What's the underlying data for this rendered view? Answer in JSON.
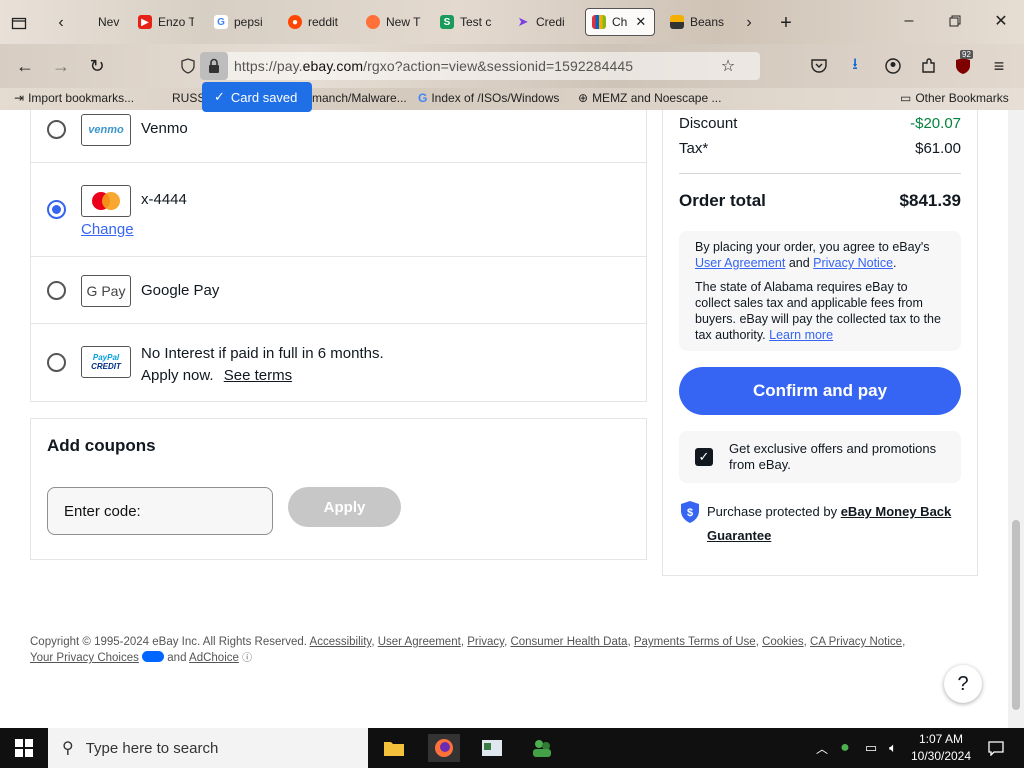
{
  "browser": {
    "tabs": [
      {
        "label": "Nev",
        "fav_color": "#7a7a7a",
        "fav_glyph": "▢"
      },
      {
        "label": "Enzo T",
        "fav_color": "#e62117",
        "fav_glyph": "▶"
      },
      {
        "label": "pepsi",
        "fav_color": "#4285f4",
        "fav_glyph": "G"
      },
      {
        "label": "reddit",
        "fav_color": "#ff4500",
        "fav_glyph": "●"
      },
      {
        "label": "New T",
        "fav_color": "#ff7139",
        "fav_glyph": "●"
      },
      {
        "label": "Test c",
        "fav_color": "#1a9b5c",
        "fav_glyph": "S"
      },
      {
        "label": "Credi",
        "fav_color": "#7b3fe4",
        "fav_glyph": "➤"
      },
      {
        "label": "Ch",
        "fav_color": "#e43137",
        "fav_glyph": "■"
      },
      {
        "label": "Beans",
        "fav_color": "#333333",
        "fav_glyph": "■"
      }
    ],
    "url_prefix": "https://pay.",
    "url_domain": "ebay.com",
    "url_rest": "/rgxo?action=view&sessionid=1592284445",
    "bookmarks": [
      "Import bookmarks...",
      "RUSSI",
      "manch/Malware...",
      "Index of /ISOs/Windows",
      "MEMZ and Noescape ...",
      "Other Bookmarks"
    ],
    "toast": "Card saved",
    "badge": "92"
  },
  "payment": {
    "options": [
      {
        "label": "Venmo",
        "logo": "venmo"
      },
      {
        "label": "x-4444",
        "logo": "mastercard",
        "change_label": "Change"
      },
      {
        "label": "Google Pay",
        "logo": "G Pay"
      },
      {
        "label": "No Interest if paid in full in 6 months.",
        "label2": "Apply now.",
        "terms_label": "See terms",
        "logo_line1": "PayPal",
        "logo_line2": "CREDIT"
      }
    ]
  },
  "coupons": {
    "title": "Add coupons",
    "placeholder": "Enter code:",
    "apply_label": "Apply"
  },
  "summary": {
    "discount_label": "Discount",
    "discount_value": "-$20.07",
    "tax_label": "Tax*",
    "tax_value": "$61.00",
    "total_label": "Order total",
    "total_value": "$841.39",
    "legal_intro": "By placing your order, you agree to eBay's",
    "legal_link1": "User Agreement",
    "legal_and": "and",
    "legal_link2": "Privacy Notice",
    "legal_tax": "The state of Alabama requires eBay to collect sales tax and applicable fees from buyers. eBay will pay the collected tax to the tax authority.",
    "learn_more": "Learn more",
    "confirm_label": "Confirm and pay",
    "offers_text": "Get exclusive offers and promotions from eBay.",
    "protect_text": "Purchase protected by",
    "protect_link": "eBay Money Back Guarantee"
  },
  "footer": {
    "copyright": "Copyright © 1995-2024 eBay Inc. All Rights Reserved.",
    "links": [
      "Accessibility",
      "User Agreement",
      "Privacy",
      "Consumer Health Data",
      "Payments Terms of Use",
      "Cookies",
      "CA Privacy Notice"
    ],
    "privacy_choices": "Your Privacy Choices",
    "and": "and",
    "adchoice": "AdChoice"
  },
  "taskbar": {
    "search_placeholder": "Type here to search",
    "time": "1:07 AM",
    "date": "10/30/2024"
  },
  "colors": {
    "accent": "#3665f3",
    "discount_green": "#05823f"
  }
}
